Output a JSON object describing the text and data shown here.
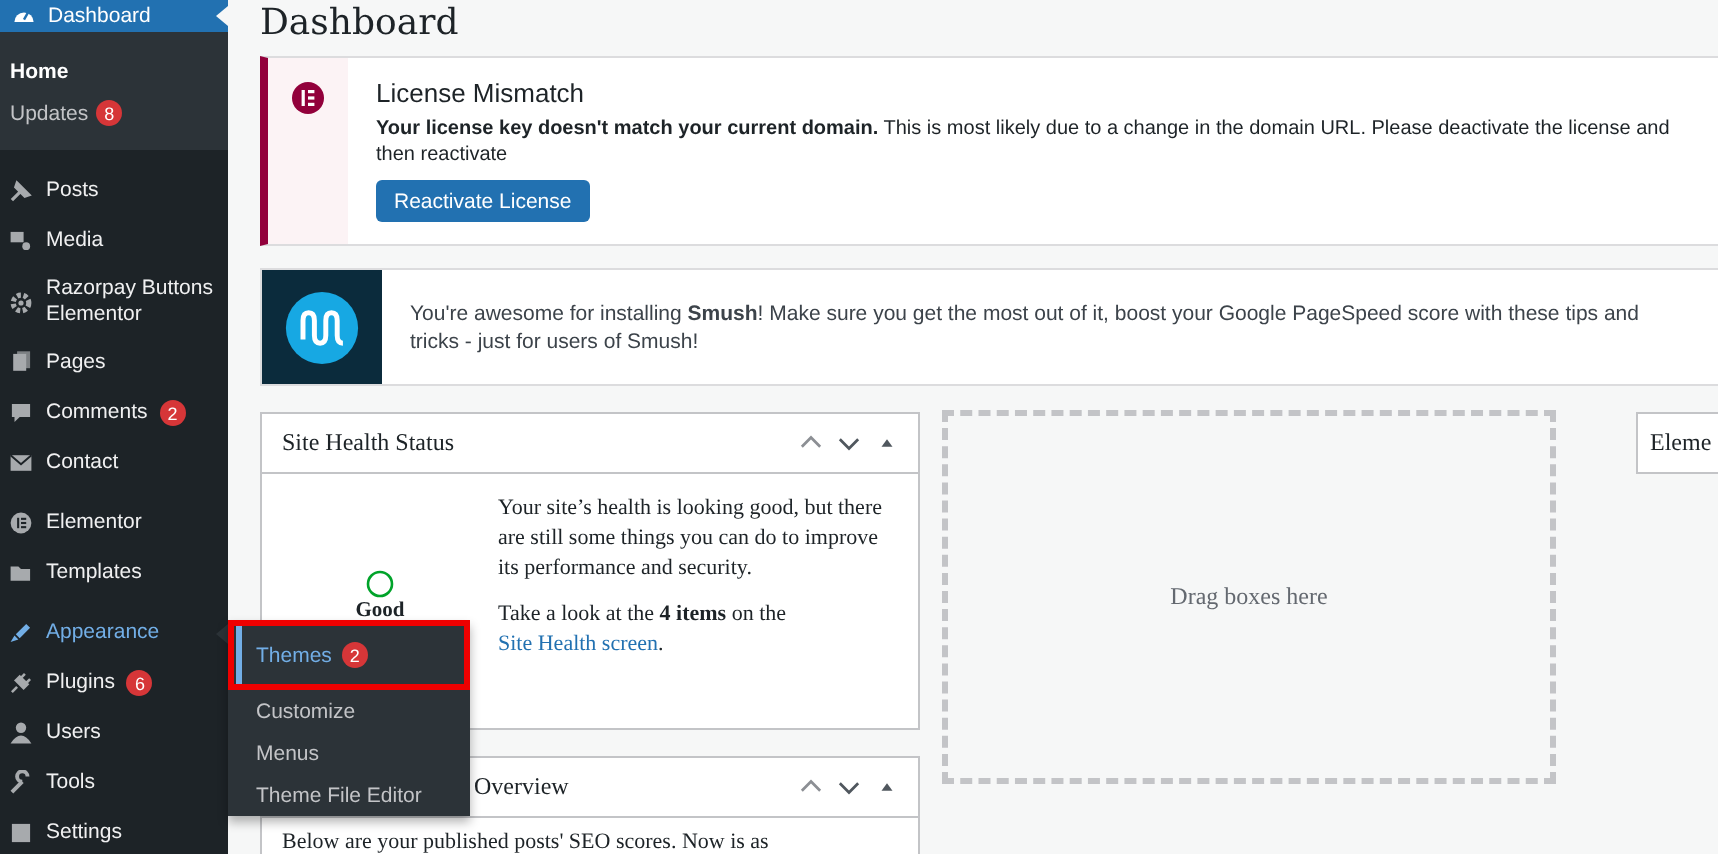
{
  "sidebar": {
    "dashboard": {
      "label": "Dashboard",
      "selected": true
    },
    "submenu": [
      {
        "label": "Home",
        "selected": true
      },
      {
        "label": "Updates",
        "selected": false,
        "badge": "8"
      }
    ],
    "groups": [
      [
        {
          "label": "Posts",
          "selected": false
        },
        {
          "label": "Media",
          "selected": false
        },
        {
          "label": "Razorpay Buttons Elementor",
          "selected": false
        },
        {
          "label": "Pages",
          "selected": false
        },
        {
          "label": "Comments",
          "selected": false,
          "badge": "2"
        },
        {
          "label": "Contact",
          "selected": false
        }
      ],
      [
        {
          "label": "Elementor",
          "selected": false
        },
        {
          "label": "Templates",
          "selected": false
        }
      ],
      [
        {
          "label": "Appearance",
          "selected": true
        },
        {
          "label": "Plugins",
          "selected": false,
          "badge": "6"
        },
        {
          "label": "Users",
          "selected": false
        },
        {
          "label": "Tools",
          "selected": false
        },
        {
          "label": "Settings",
          "selected": false
        }
      ]
    ]
  },
  "flyout": [
    {
      "label": "Themes",
      "selected": true,
      "badge": "2",
      "highlighted": true
    },
    {
      "label": "Customize",
      "selected": false,
      "highlighted": false
    },
    {
      "label": "Menus",
      "selected": false,
      "highlighted": false
    },
    {
      "label": "Theme File Editor",
      "selected": false,
      "highlighted": false
    }
  ],
  "page_title": "Dashboard",
  "license_notice": {
    "title": "License Mismatch",
    "message": "**Your license key doesn't match your current domain.** This is most likely due to a change in the domain URL. Please deactivate the license and then reactivate",
    "button": "Reactivate License"
  },
  "smush_notice": {
    "message": "You're awesome for installing **Smush**! Make sure you get the most out of it, boost your Google PageSpeed score with these tips and tricks - just for users of Smush!"
  },
  "site_health": {
    "title": "Site Health Status",
    "status": "Good",
    "text": "Your site’s health is looking good, but there are still some things you can do to improve its performance and security.",
    "text2_before": "Take a look at the **4 items** on the",
    "link": "Site Health screen",
    "text2_after": "."
  },
  "overview": {
    "title": "Overview",
    "text": "Below are your published posts' SEO scores. Now is as"
  },
  "drop_zone": "Drag boxes here",
  "cut_widget": {
    "title": "Eleme"
  }
}
